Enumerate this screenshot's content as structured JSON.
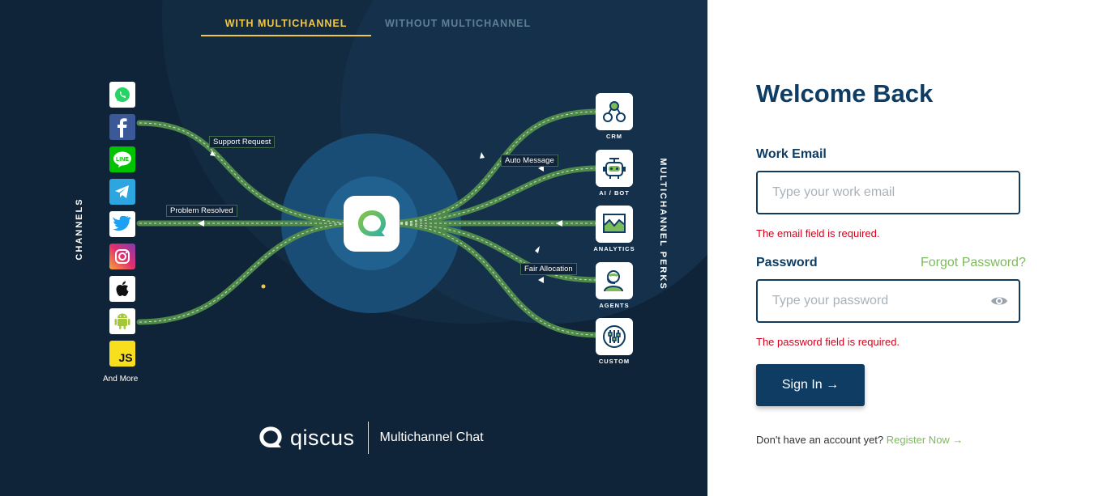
{
  "tabs": [
    {
      "label": "WITH MULTICHANNEL",
      "active": true
    },
    {
      "label": "WITHOUT MULTICHANNEL",
      "active": false
    }
  ],
  "diagram": {
    "left_label": "CHANNELS",
    "right_label": "MULTICHANNEL PERKS",
    "channels": [
      {
        "name": "whatsapp-icon"
      },
      {
        "name": "facebook-icon"
      },
      {
        "name": "line-icon"
      },
      {
        "name": "telegram-icon"
      },
      {
        "name": "twitter-icon"
      },
      {
        "name": "instagram-icon"
      },
      {
        "name": "apple-icon"
      },
      {
        "name": "android-icon"
      },
      {
        "name": "javascript-icon",
        "text": "JS"
      }
    ],
    "and_more": "And More",
    "perks": [
      {
        "label": "CRM",
        "icon": "crm-icon"
      },
      {
        "label": "AI / BOT",
        "icon": "bot-icon"
      },
      {
        "label": "ANALYTICS",
        "icon": "analytics-icon"
      },
      {
        "label": "AGENTS",
        "icon": "agent-icon"
      },
      {
        "label": "CUSTOM",
        "icon": "custom-icon"
      }
    ],
    "route_labels": {
      "support_request": "Support Request",
      "problem_resolved": "Problem Resolved",
      "auto_message": "Auto Message",
      "fair_allocation": "Fair Allocation"
    },
    "colors": {
      "road": "#4f8a4b",
      "road_dash": "#d9ead3",
      "hub_outer": "#1a4d75",
      "hub_inner": "#20618f"
    }
  },
  "brand": {
    "name": "qiscus",
    "tagline": "Multichannel Chat"
  },
  "login": {
    "title": "Welcome Back",
    "email": {
      "label": "Work Email",
      "placeholder": "Type your work email",
      "value": "",
      "error": "The email field is required."
    },
    "password": {
      "label": "Password",
      "placeholder": "Type your password",
      "value": "",
      "error": "The password field is required."
    },
    "forgot": "Forgot Password?",
    "submit": "Sign In →",
    "register_prompt": "Don't have an account yet?",
    "register_link": "Register Now →",
    "colors": {
      "primary": "#0e3c62",
      "accent": "#7bbb5a",
      "error": "#d0021b"
    }
  }
}
